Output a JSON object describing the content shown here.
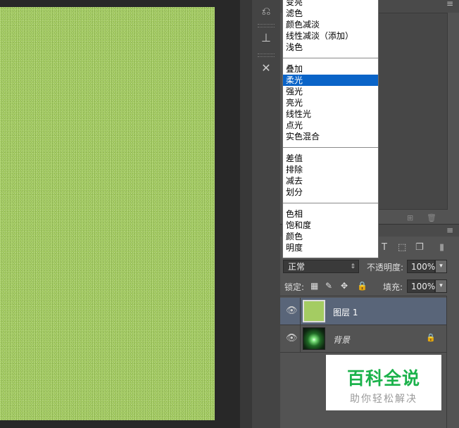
{
  "blend_modes": {
    "group1": [
      "变亮",
      "滤色",
      "颜色减淡",
      "线性减淡（添加）",
      "浅色"
    ],
    "group2": [
      "叠加",
      "柔光",
      "强光",
      "亮光",
      "线性光",
      "点光",
      "实色混合"
    ],
    "group3": [
      "差值",
      "排除",
      "减去",
      "划分"
    ],
    "group4": [
      "色相",
      "饱和度",
      "颜色",
      "明度"
    ],
    "highlighted": "柔光"
  },
  "layers_panel": {
    "blend_mode_value": "正常",
    "opacity_label": "不透明度:",
    "opacity_value": "100%",
    "lock_label": "锁定:",
    "fill_label": "填充:",
    "fill_value": "100%",
    "layers": [
      {
        "name": "图层 1",
        "selected": true,
        "visible": true
      },
      {
        "name": "背景",
        "selected": false,
        "visible": true,
        "locked": true
      }
    ]
  },
  "watermark": {
    "title": "百科全说",
    "subtitle": "助你轻松解决"
  },
  "colors": {
    "canvas_green": "#a4cc62",
    "selection_blue": "#0a64c8",
    "selected_layer": "#596579",
    "watermark_green": "#1bb24b"
  },
  "icons": [
    "history-icon",
    "stamp-icon",
    "tools-icon",
    "eye-icon",
    "lock-icon",
    "text-filter-icon",
    "shape-filter-icon",
    "smart-filter-icon",
    "move-lock-icon",
    "brush-lock-icon",
    "transparency-lock-icon"
  ]
}
